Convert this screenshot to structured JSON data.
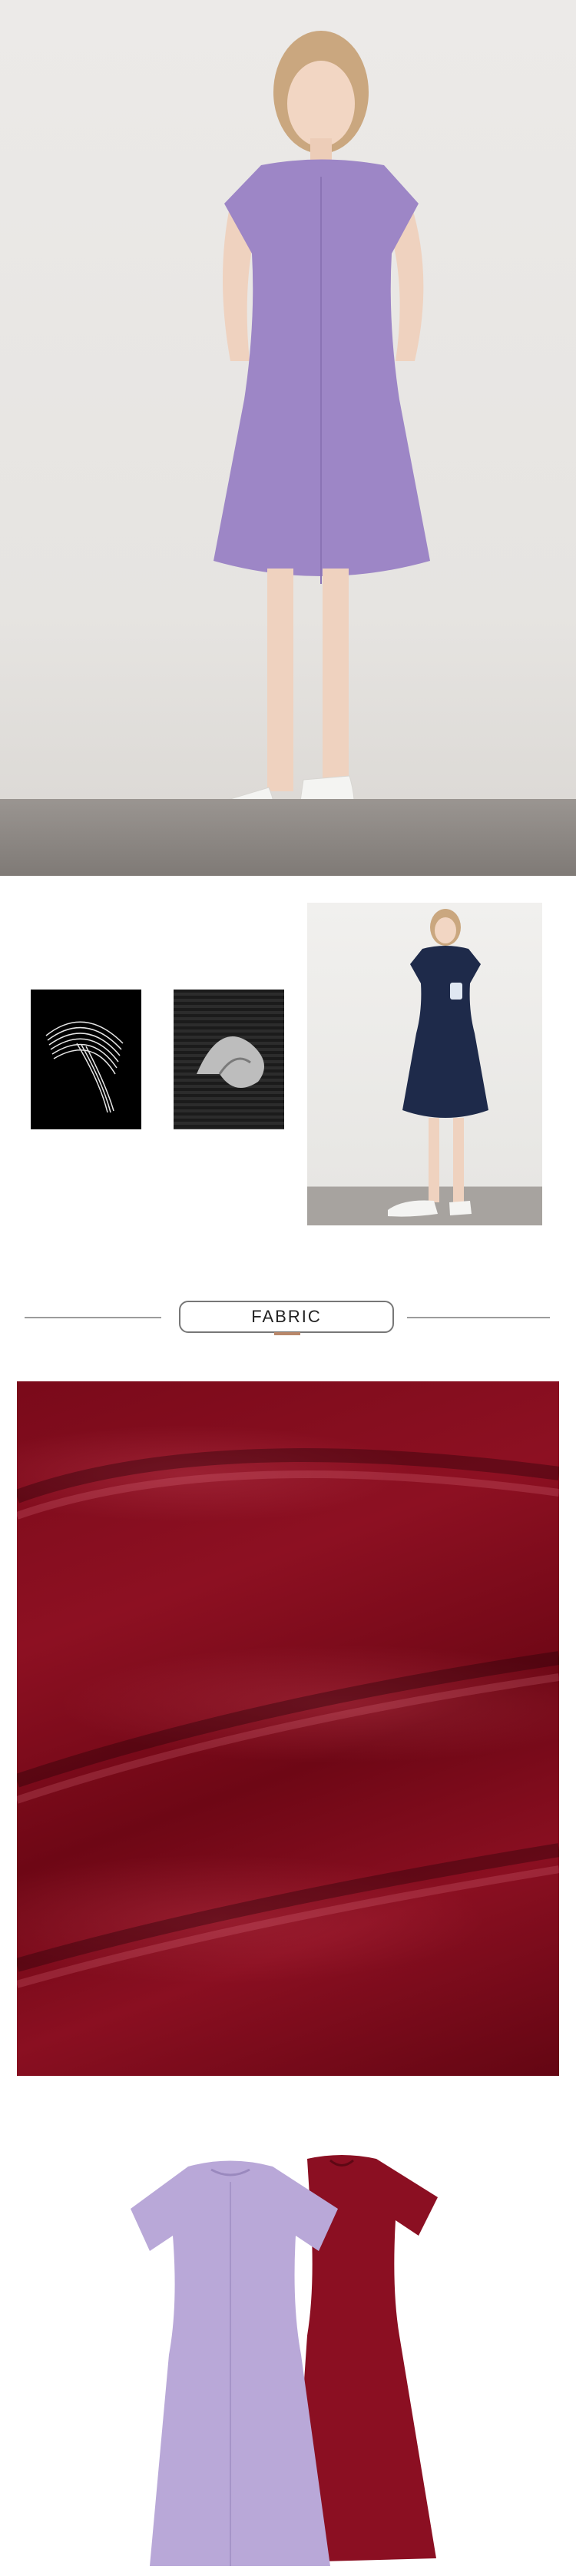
{
  "section": {
    "fabric_label": "FABRIC"
  },
  "colors": {
    "lavender": "#9d86c6",
    "navy": "#1e2a4a",
    "burgundy": "#8b0f22"
  }
}
